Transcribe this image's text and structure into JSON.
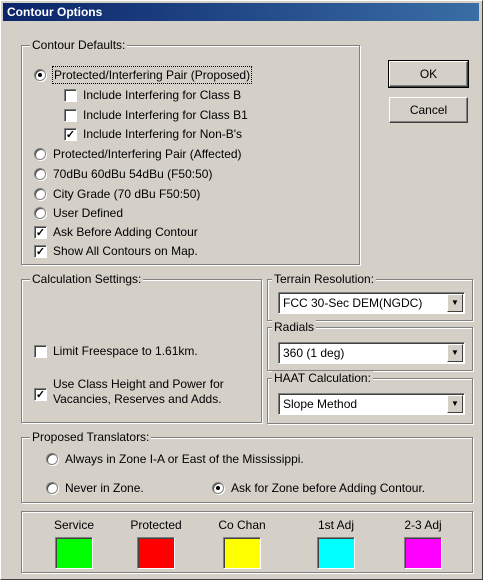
{
  "window": {
    "title": "Contour Options"
  },
  "buttons": {
    "ok": "OK",
    "cancel": "Cancel"
  },
  "contour_defaults": {
    "title": "Contour Defaults:",
    "protected_pair": {
      "label": "Protected/Interfering Pair (Proposed)",
      "selected": true
    },
    "include_class_b": {
      "label": "Include Interfering for Class B",
      "checked": false
    },
    "include_class_b1": {
      "label": "Include Interfering for Class B1",
      "checked": false
    },
    "include_non_b": {
      "label": "Include Interfering for Non-B's",
      "checked": true
    },
    "affected_pair": {
      "label": "Protected/Interfering Pair (Affected)",
      "selected": false
    },
    "dbu_levels": {
      "label": "70dBu 60dBu 54dBu (F50:50)",
      "selected": false
    },
    "city_grade": {
      "label": "City Grade (70 dBu F50:50)",
      "selected": false
    },
    "user_defined": {
      "label": "User Defined",
      "selected": false
    },
    "ask_before_adding": {
      "label": "Ask Before Adding Contour",
      "checked": true
    },
    "show_all_contours": {
      "label": "Show All Contours on Map.",
      "checked": true
    }
  },
  "calculation": {
    "title": "Calculation Settings:",
    "limit_freespace": {
      "label": "Limit Freespace to 1.61km.",
      "checked": false
    },
    "use_class_height": {
      "line1": "Use Class Height and Power for",
      "line2": "Vacancies, Reserves and Adds.",
      "checked": true
    }
  },
  "terrain": {
    "title": "Terrain Resolution:",
    "value": "FCC 30-Sec DEM(NGDC)"
  },
  "radials": {
    "title": "Radials",
    "value": "360 (1 deg)"
  },
  "haat": {
    "title": "HAAT Calculation:",
    "value": "Slope Method"
  },
  "translators": {
    "title": "Proposed Translators:",
    "always_zone": {
      "label": "Always in Zone I-A or East of the Mississippi.",
      "selected": false
    },
    "never_zone": {
      "label": "Never in Zone.",
      "selected": false
    },
    "ask_zone": {
      "label": "Ask for Zone before Adding Contour.",
      "selected": true
    }
  },
  "colors": {
    "items": [
      {
        "label": "Service",
        "color": "#00ff00"
      },
      {
        "label": "Protected",
        "color": "#ff0000"
      },
      {
        "label": "Co Chan",
        "color": "#ffff00"
      },
      {
        "label": "1st Adj",
        "color": "#00ffff"
      },
      {
        "label": "2-3 Adj",
        "color": "#ff00ff"
      }
    ]
  },
  "icons": {
    "check": "✓",
    "dropdown": "dropdown-arrow-icon"
  }
}
